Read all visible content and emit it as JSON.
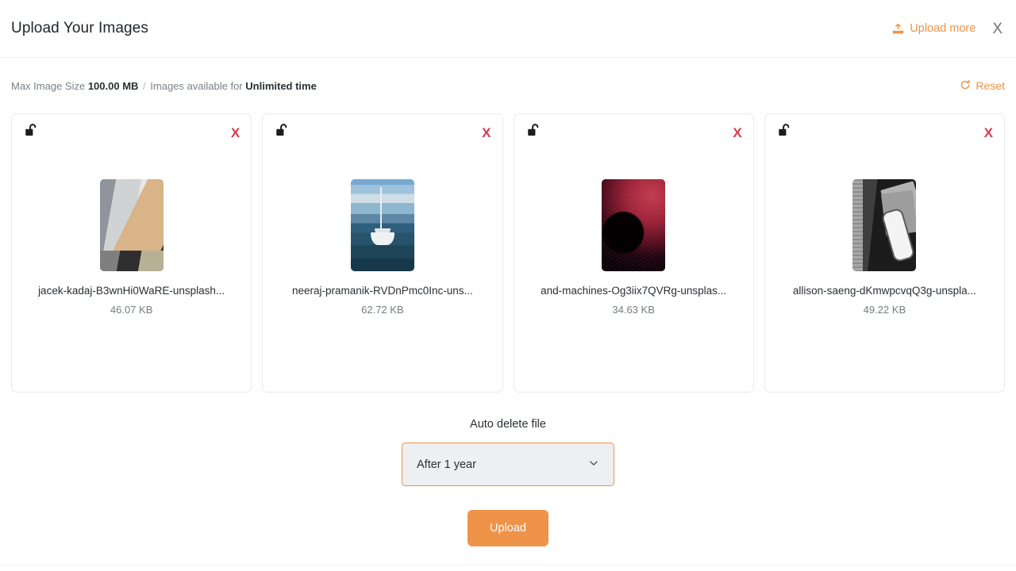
{
  "header": {
    "title": "Upload Your Images",
    "upload_more_label": "Upload more",
    "upload_more_icon": "upload-icon",
    "close_icon": "close-icon",
    "close_label": "X",
    "accent_color": "#ef9349"
  },
  "subbar": {
    "max_size_prefix": "Max Image Size",
    "max_size_value": "100.00 MB",
    "separator": "/",
    "availability_prefix": "Images available for",
    "availability_value": "Unlimited time",
    "reset_label": "Reset",
    "reset_icon": "refresh-icon"
  },
  "cards": [
    {
      "lock_icon": "unlock-icon",
      "remove_icon": "close-icon",
      "remove_label": "X",
      "thumbnail": "interior-walls-photo",
      "file_name": "jacek-kadaj-B3wnHi0WaRE-unsplash...",
      "file_size": "46.07 KB"
    },
    {
      "lock_icon": "unlock-icon",
      "remove_icon": "close-icon",
      "remove_label": "X",
      "thumbnail": "sailboat-ocean-photo",
      "file_name": "neeraj-pramanik-RVDnPmc0Inc-uns...",
      "file_size": "62.72 KB"
    },
    {
      "lock_icon": "unlock-icon",
      "remove_icon": "close-icon",
      "remove_label": "X",
      "thumbnail": "dark-red-abstract-photo",
      "file_name": "and-machines-Og3iix7QVRg-unsplas...",
      "file_size": "34.63 KB"
    },
    {
      "lock_icon": "unlock-icon",
      "remove_icon": "close-icon",
      "remove_label": "X",
      "thumbnail": "phone-on-papers-photo",
      "file_name": "allison-saeng-dKmwpcvqQ3g-unspla...",
      "file_size": "49.22 KB"
    }
  ],
  "footer": {
    "auto_delete_label": "Auto delete file",
    "auto_delete_value": "After 1 year",
    "chevron_icon": "chevron-down-icon",
    "upload_button_label": "Upload"
  }
}
